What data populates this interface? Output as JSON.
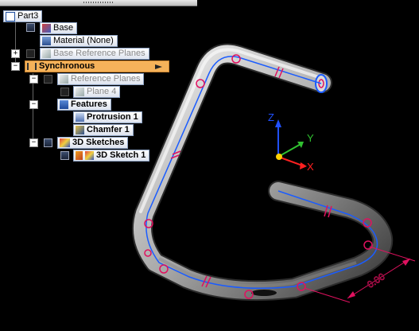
{
  "tree": {
    "part": "Part3",
    "base": "Base",
    "material": "Material (None)",
    "base_ref_planes": "Base Reference Planes",
    "synchronous": "Synchronous",
    "ref_planes": "Reference Planes",
    "plane4": "Plane 4",
    "features": "Features",
    "protrusion": "Protrusion 1",
    "chamfer": "Chamfer 1",
    "sketches_3d": "3D Sketches",
    "sketch_3d_1": "3D Sketch 1"
  },
  "expanders": {
    "minus": "−",
    "plus": "+"
  },
  "triad": {
    "x": "X",
    "y": "Y",
    "z": "Z"
  },
  "dimension": {
    "value": "0.00"
  },
  "colors": {
    "tube_light": "#e6e6e6",
    "tube_dark": "#4a4a4a",
    "path_line": "#1a5cff",
    "constraint": "#e0115f",
    "selected": "#f5b25a",
    "axis_x": "#ff2020",
    "axis_y": "#30c030",
    "axis_z": "#2050ff"
  }
}
